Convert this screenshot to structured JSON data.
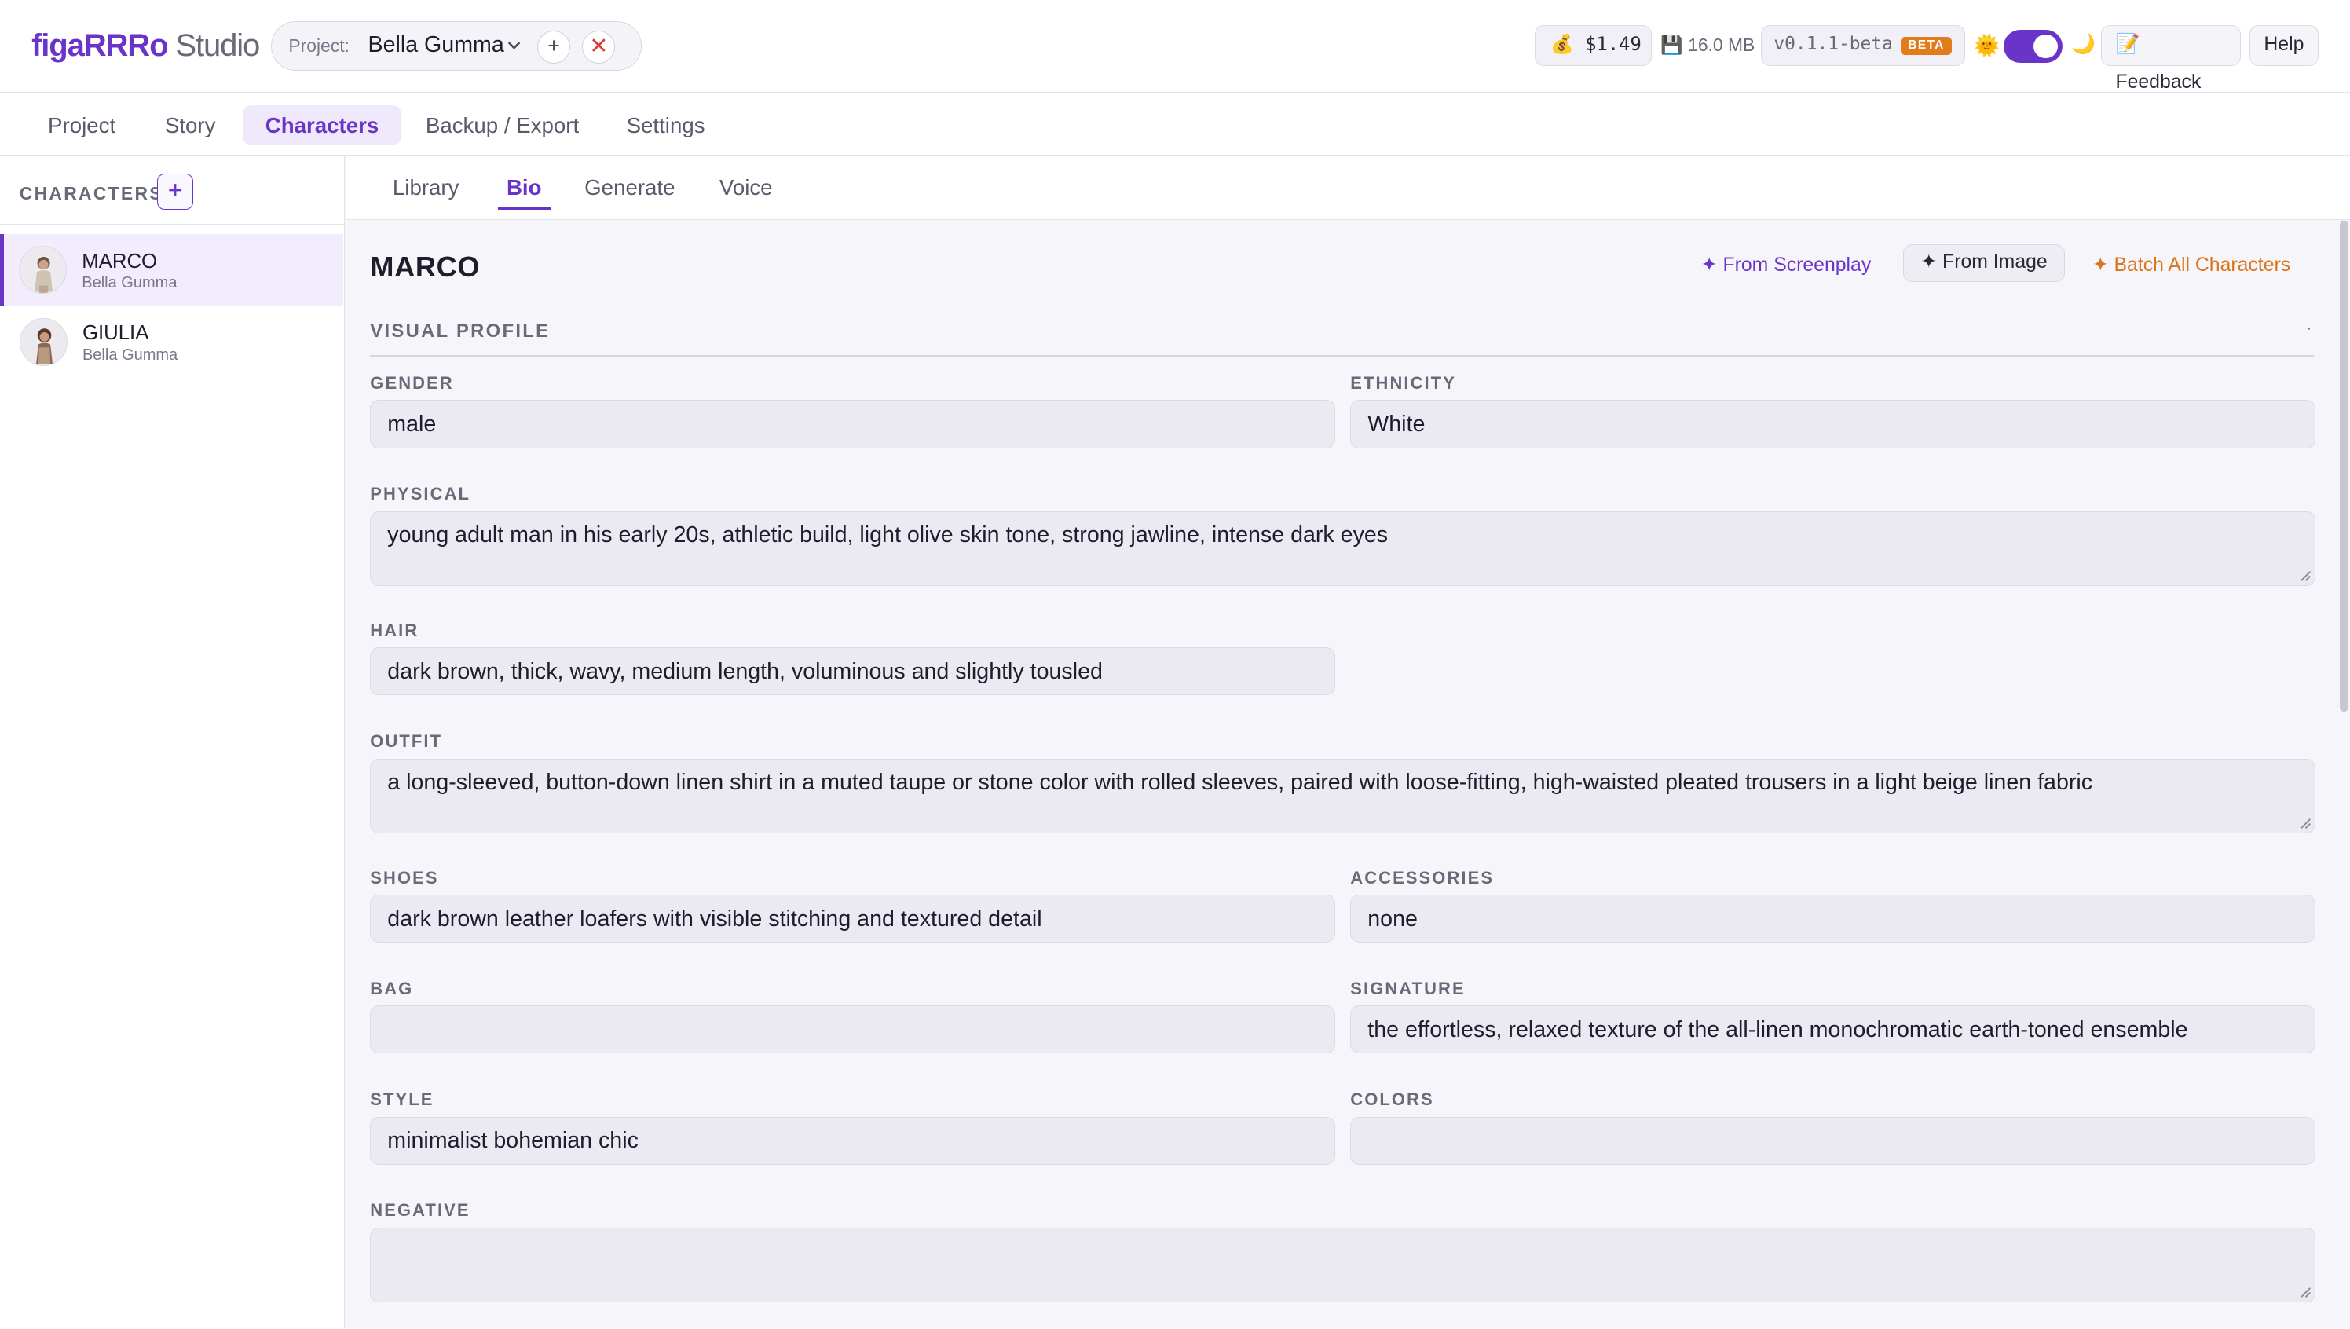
{
  "app": {
    "logo_part1": "figaRRRo",
    "logo_part2": " Studio",
    "project_label": "Project:",
    "project_name": "Bella Gumma",
    "add_project": "+",
    "close_project": "✕",
    "cost": "💰 $1.49",
    "storage": "💾 16.0 MB",
    "version": "v0.1.1-beta",
    "beta_badge": "BETA",
    "sun_icon": "🌞",
    "moon_icon": "🌙",
    "feedback": "📝 Feedback",
    "help": "Help"
  },
  "nav": {
    "tabs": [
      "Project",
      "Story",
      "Characters",
      "Backup / Export",
      "Settings"
    ],
    "active": "Characters"
  },
  "sidebar": {
    "title": "CHARACTERS",
    "add": "+",
    "characters": [
      {
        "name": "MARCO",
        "project": "Bella Gumma",
        "active": true
      },
      {
        "name": "GIULIA",
        "project": "Bella Gumma",
        "active": false
      }
    ]
  },
  "subtabs": {
    "items": [
      "Library",
      "Bio",
      "Generate",
      "Voice"
    ],
    "active": "Bio"
  },
  "bio": {
    "character": "MARCO",
    "from_screenplay": "✦ From Screenplay",
    "from_image": "✦ From Image",
    "batch": "✦ Batch All Characters",
    "section": "VISUAL PROFILE",
    "section_dot": "·",
    "fields": {
      "gender": {
        "label": "GENDER",
        "value": "male"
      },
      "ethnicity": {
        "label": "ETHNICITY",
        "value": "White"
      },
      "physical": {
        "label": "PHYSICAL",
        "value": "young adult man in his early 20s, athletic build, light olive skin tone, strong jawline, intense dark eyes"
      },
      "hair": {
        "label": "HAIR",
        "value": "dark brown, thick, wavy, medium length, voluminous and slightly tousled"
      },
      "outfit": {
        "label": "OUTFIT",
        "value": "a long-sleeved, button-down linen shirt in a muted taupe or stone color with rolled sleeves, paired with loose-fitting, high-waisted pleated trousers in a light beige linen fabric"
      },
      "shoes": {
        "label": "SHOES",
        "value": "dark brown leather loafers with visible stitching and textured detail"
      },
      "accessories": {
        "label": "ACCESSORIES",
        "value": "none"
      },
      "bag": {
        "label": "BAG",
        "value": ""
      },
      "signature": {
        "label": "SIGNATURE",
        "value": "the effortless, relaxed texture of the all-linen monochromatic earth-toned ensemble"
      },
      "style": {
        "label": "STYLE",
        "value": "minimalist bohemian chic"
      },
      "colors": {
        "label": "COLORS",
        "value": ""
      },
      "negative": {
        "label": "NEGATIVE",
        "value": ""
      }
    }
  },
  "colors": {
    "accent": "#6a34c9",
    "batch": "#d9751a",
    "beta": "#e07c1a",
    "close": "#d33b3b"
  }
}
